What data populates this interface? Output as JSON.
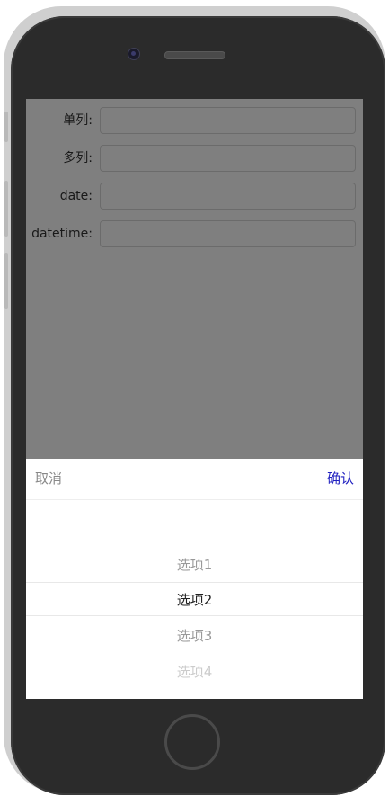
{
  "form": {
    "fields": [
      {
        "label": "单列:",
        "value": ""
      },
      {
        "label": "多列:",
        "value": ""
      },
      {
        "label": "date:",
        "value": ""
      },
      {
        "label": "datetime:",
        "value": ""
      }
    ]
  },
  "picker": {
    "cancel_label": "取消",
    "confirm_label": "确认",
    "options": [
      "选项1",
      "选项2",
      "选项3",
      "选项4"
    ],
    "selected": "选项2"
  },
  "colors": {
    "confirm": "#2020c0",
    "cancel": "#888888",
    "mask": "rgba(0,0,0,0.5)"
  }
}
